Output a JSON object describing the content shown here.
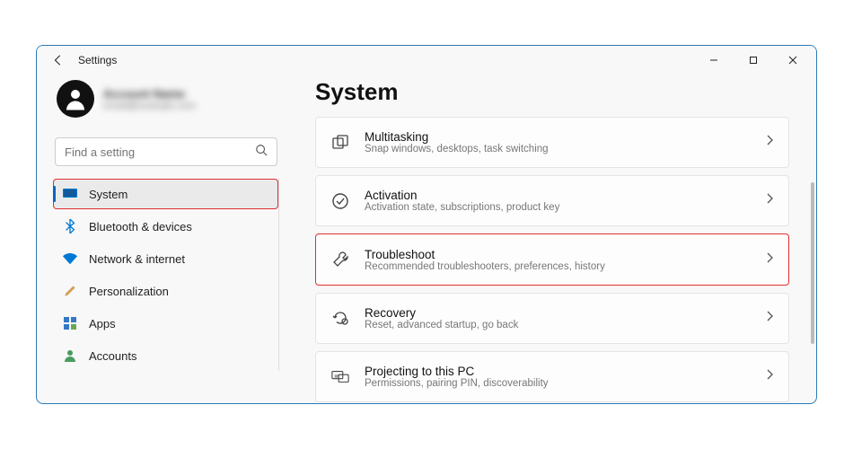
{
  "app_title": "Settings",
  "profile": {
    "name": "Account Name",
    "email": "email@example.com"
  },
  "search": {
    "placeholder": "Find a setting"
  },
  "nav": {
    "items": [
      {
        "id": "system",
        "label": "System",
        "icon": "monitor",
        "selected": true,
        "highlight": true
      },
      {
        "id": "bluetooth",
        "label": "Bluetooth & devices",
        "icon": "bluetooth"
      },
      {
        "id": "network",
        "label": "Network & internet",
        "icon": "wifi"
      },
      {
        "id": "personalization",
        "label": "Personalization",
        "icon": "brush"
      },
      {
        "id": "apps",
        "label": "Apps",
        "icon": "apps"
      },
      {
        "id": "accounts",
        "label": "Accounts",
        "icon": "person"
      }
    ]
  },
  "page": {
    "title": "System",
    "cards": [
      {
        "id": "multitasking",
        "title": "Multitasking",
        "subtitle": "Snap windows, desktops, task switching",
        "icon": "multitask"
      },
      {
        "id": "activation",
        "title": "Activation",
        "subtitle": "Activation state, subscriptions, product key",
        "icon": "check-circle"
      },
      {
        "id": "troubleshoot",
        "title": "Troubleshoot",
        "subtitle": "Recommended troubleshooters, preferences, history",
        "icon": "wrench",
        "highlight": true
      },
      {
        "id": "recovery",
        "title": "Recovery",
        "subtitle": "Reset, advanced startup, go back",
        "icon": "recovery"
      },
      {
        "id": "projecting",
        "title": "Projecting to this PC",
        "subtitle": "Permissions, pairing PIN, discoverability",
        "icon": "project"
      }
    ]
  }
}
